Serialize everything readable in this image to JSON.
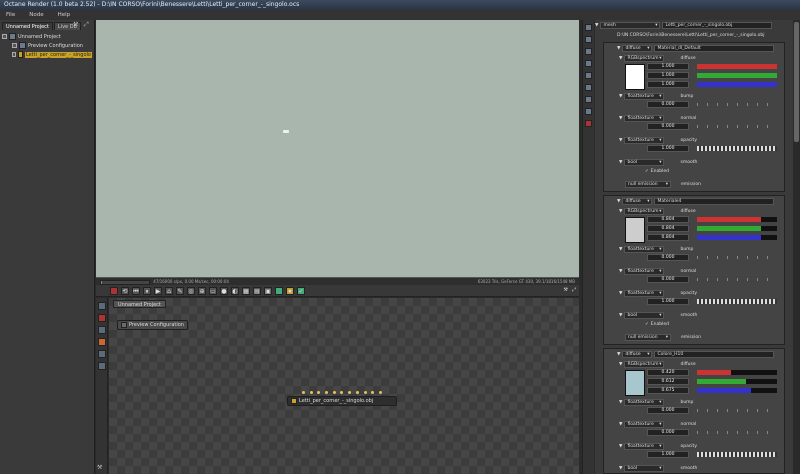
{
  "window": {
    "title": "Octane Render (1.0 beta 2.52) - D:\\IN CORSO\\Forini\\Benessere\\Letti\\Letti_per_corner_-_singolo.ocs"
  },
  "menu": {
    "items": [
      "File",
      "Node",
      "Help"
    ]
  },
  "outliner": {
    "tabs": [
      "Unnamed Project",
      "Live DB"
    ],
    "items": [
      {
        "label": "Unnamed Project"
      },
      {
        "label": "Preview Configuration"
      },
      {
        "label": "Letti_per_corner_-_singolo"
      }
    ]
  },
  "status": {
    "left": "47/16000 s/px, 0.00 Ms/sec, 00:00:04",
    "right": "63023 Tris, GeForce GT 430, 39.1/1816/1548 MB",
    "progress": 0.003
  },
  "graph": {
    "tab": "Unnamed Project",
    "node_preview": "Preview Configuration",
    "node_mesh": "Letti_per_corner_-_singolo.obj"
  },
  "inspector": {
    "header_type": "mesh",
    "header_name": "Letti_per_corner_-_singolo.obj",
    "path": "D:\\IN CORSO\\Forini\\Benessere\\Letti\\Letti_per_corner_-_singolo.obj",
    "materials": [
      {
        "type": "diffuse",
        "name": "Material_dl_Default",
        "color": "#ffffff",
        "rgb": [
          "1.000",
          "1.000",
          "1.000"
        ],
        "rgb_fractions": [
          1.0,
          1.0,
          1.0
        ],
        "bump": "0.000",
        "normal": "0.000",
        "opacity": "1.000",
        "smooth": "Enabled",
        "emission": "null emission"
      },
      {
        "type": "diffuse",
        "name": "Materiale4",
        "color": "#cdcdcd",
        "rgb": [
          "0.804",
          "0.804",
          "0.804"
        ],
        "rgb_fractions": [
          0.804,
          0.804,
          0.804
        ],
        "bump": "0.000",
        "normal": "0.000",
        "opacity": "1.000",
        "smooth": "Enabled",
        "emission": "null emission"
      },
      {
        "type": "diffuse",
        "name": "Colore_H10",
        "color": "#a8c6ce",
        "rgb": [
          "0.420",
          "0.612",
          "0.675"
        ],
        "rgb_fractions": [
          0.42,
          0.612,
          0.675
        ],
        "bump": "0.000",
        "normal": "0.000",
        "opacity": "1.000",
        "smooth": "smooth"
      }
    ],
    "labels": {
      "rgb": "RGBspectrum",
      "diffuse": "diffuse",
      "float": "floattexture",
      "bump": "bump",
      "normal": "normal",
      "opacity": "opacity",
      "bool": "bool",
      "smooth": "smooth",
      "emission": "emission"
    }
  }
}
